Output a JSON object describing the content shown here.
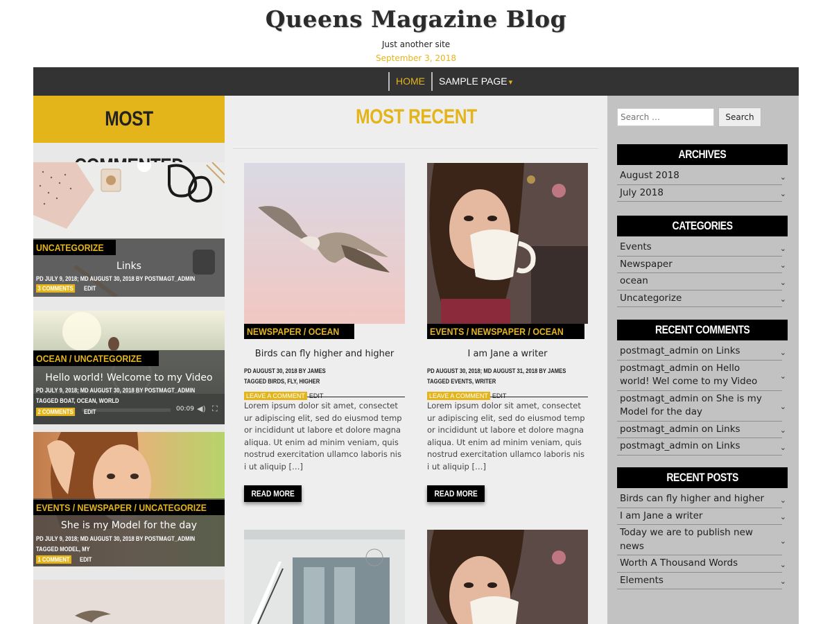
{
  "site": {
    "title": "Queens Magazine Blog",
    "description": "Just another site",
    "date": "September 3, 2018"
  },
  "nav": {
    "items": [
      {
        "label": "HOME",
        "active": true
      },
      {
        "label": "SAMPLE PAGE",
        "has_dropdown": true
      }
    ],
    "dropdown_icon": "▾"
  },
  "colors": {
    "accent": "#e4b51a",
    "nav_bg": "#333333",
    "sidebar_bg": "#c2c2c2"
  },
  "most_commented": {
    "heading": "MOST COMMENTED",
    "posts": [
      {
        "image": "desk-flatlay-glasses-watch",
        "category": "UNCATEGORIZE",
        "title": "Links",
        "meta": "PD JULY 9, 2018; MD AUGUST 30, 2018 BY POSTMAGT_ADMIN",
        "comments": "3 COMMENTS",
        "edit": "EDIT"
      },
      {
        "image": "video-balloon-sky",
        "category": "OCEAN / UNCATEGORIZE",
        "title": "Hello world! Welcome to my Video",
        "meta": "PD JULY 9, 2018; MD AUGUST 30, 2018 BY POSTMAGT_ADMIN",
        "tags": "TAGGED BOAT, OCEAN, WORLD",
        "comments": "2 COMMENTS",
        "edit": "EDIT",
        "video_time": "00:09"
      },
      {
        "image": "woman-portrait",
        "category": "EVENTS / NEWSPAPER / UNCATEGORIZE",
        "title": "She is my Model for the day",
        "meta": "PD JULY 9, 2018; MD AUGUST 30, 2018 BY POSTMAGT_ADMIN",
        "tags": "TAGGED MODEL, MY",
        "comments": "1 COMMENT",
        "edit": "EDIT"
      }
    ]
  },
  "most_recent": {
    "heading": "MOST RECENT",
    "posts": [
      {
        "image": "seagull-flying",
        "category": "NEWSPAPER / OCEAN",
        "title": "Birds can fly higher and higher",
        "meta": "PD AUGUST 30, 2018 BY JAMES",
        "tags": "TAGGED BIRDS, FLY, HIGHER",
        "comment_badge": "LEAVE A COMMENT",
        "edit": "EDIT",
        "excerpt": "Lorem ipsum dolor sit amet, consectet ur adipiscing elit, sed do eiusmod temp or incididunt ut labore et dolore magna aliqua. Ut enim ad minim veniam, quis nostrud exercitation ullamco laboris nis i ut aliquip […]",
        "read_more": "READ MORE"
      },
      {
        "image": "woman-coffee-cup",
        "category": "EVENTS / NEWSPAPER / OCEAN",
        "title": "I am Jane a writer",
        "meta": "PD AUGUST 30, 2018; MD AUGUST 31, 2018 BY JAMES",
        "tags": "TAGGED EVENTS, WRITER",
        "comment_badge": "LEAVE A COMMENT",
        "edit": "EDIT",
        "excerpt": "Lorem ipsum dolor sit amet, consectet ur adipiscing elit, sed do eiusmod temp or incididunt ut labore et dolore magna aliqua. Ut enim ad minim veniam, quis nostrud exercitation ullamco laboris nis i ut aliquip […]",
        "read_more": "READ MORE"
      }
    ]
  },
  "sidebar": {
    "search": {
      "placeholder": "Search …",
      "button": "Search"
    },
    "archives": {
      "title": "ARCHIVES",
      "items": [
        "August 2018",
        "July 2018"
      ]
    },
    "categories": {
      "title": "CATEGORIES",
      "items": [
        "Events",
        "Newspaper",
        "ocean",
        "Uncategorize"
      ]
    },
    "recent_comments": {
      "title": "RECENT COMMENTS",
      "items": [
        "postmagt_admin on Links",
        "postmagt_admin on Hello world! Wel come to my Video",
        "postmagt_admin on She is my Model for the day",
        "postmagt_admin on Links",
        "postmagt_admin on Links"
      ]
    },
    "recent_posts": {
      "title": "RECENT POSTS",
      "items": [
        "Birds can fly higher and higher",
        "I am Jane a writer",
        "Today we are to publish new news",
        "Worth A Thousand Words",
        "Elements"
      ]
    },
    "chevron_icon": "⌄"
  }
}
